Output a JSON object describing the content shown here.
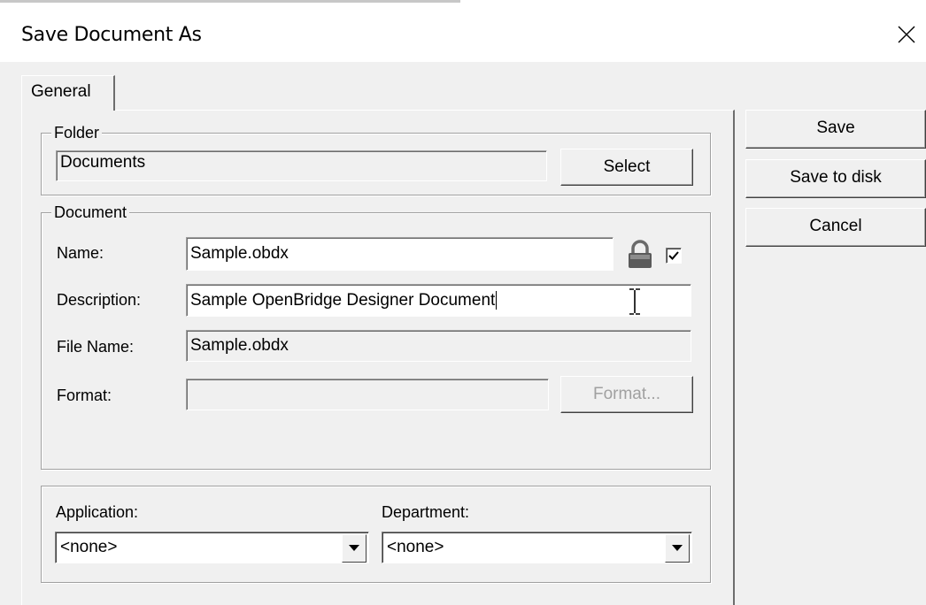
{
  "window": {
    "title": "Save Document As"
  },
  "tabs": [
    {
      "label": "General"
    }
  ],
  "folder": {
    "legend": "Folder",
    "value": "Documents",
    "select_label": "Select"
  },
  "document": {
    "legend": "Document",
    "name_label": "Name:",
    "name_value": "Sample.obdx",
    "lock_checked": true,
    "description_label": "Description:",
    "description_value": "Sample OpenBridge Designer Document",
    "file_name_label": "File Name:",
    "file_name_value": "Sample.obdx",
    "format_label": "Format:",
    "format_value": "",
    "format_button_label": "Format..."
  },
  "classification": {
    "application_label": "Application:",
    "application_value": "<none>",
    "department_label": "Department:",
    "department_value": "<none>"
  },
  "actions": {
    "save_label": "Save",
    "save_to_disk_label": "Save to disk",
    "cancel_label": "Cancel"
  }
}
